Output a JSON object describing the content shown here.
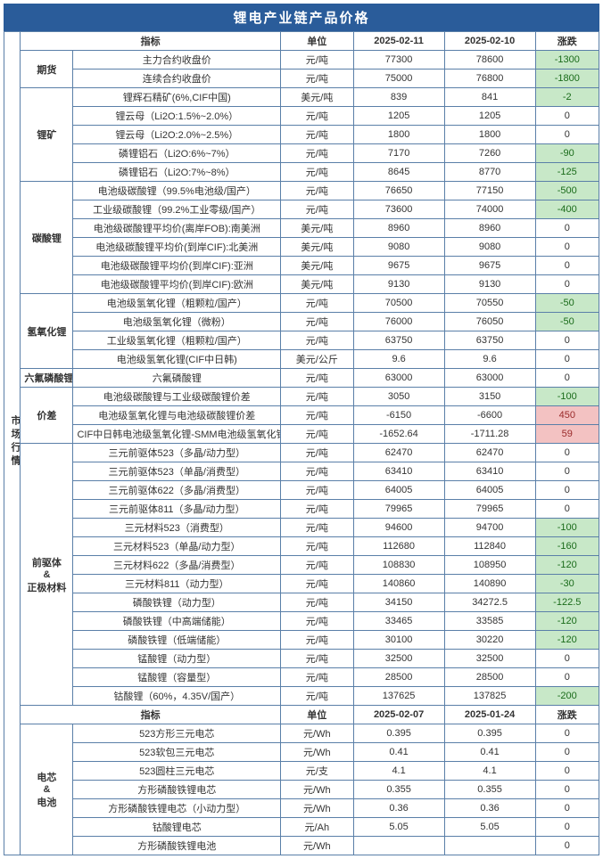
{
  "title": "锂电产业链产品价格",
  "headers1": {
    "indicator": "指标",
    "unit": "单位",
    "d1": "2025-02-11",
    "d2": "2025-02-10",
    "chg": "涨跌"
  },
  "headers2": {
    "indicator": "指标",
    "unit": "单位",
    "d1": "2025-02-07",
    "d2": "2025-01-24",
    "chg": "涨跌"
  },
  "section_main": "市场行情",
  "groups": [
    {
      "name": "期货",
      "rows": [
        {
          "ind": "主力合约收盘价",
          "unit": "元/吨",
          "v1": "77300",
          "v2": "78600",
          "chg": -1300
        },
        {
          "ind": "连续合约收盘价",
          "unit": "元/吨",
          "v1": "75000",
          "v2": "76800",
          "chg": -1800
        }
      ]
    },
    {
      "name": "锂矿",
      "rows": [
        {
          "ind": "锂辉石精矿(6%,CIF中国)",
          "unit": "美元/吨",
          "v1": "839",
          "v2": "841",
          "chg": -2
        },
        {
          "ind": "锂云母（Li2O:1.5%~2.0%）",
          "unit": "元/吨",
          "v1": "1205",
          "v2": "1205",
          "chg": 0
        },
        {
          "ind": "锂云母（Li2O:2.0%~2.5%）",
          "unit": "元/吨",
          "v1": "1800",
          "v2": "1800",
          "chg": 0
        },
        {
          "ind": "磷锂铝石（Li2O:6%~7%）",
          "unit": "元/吨",
          "v1": "7170",
          "v2": "7260",
          "chg": -90
        },
        {
          "ind": "磷锂铝石（Li2O:7%~8%）",
          "unit": "元/吨",
          "v1": "8645",
          "v2": "8770",
          "chg": -125
        }
      ]
    },
    {
      "name": "碳酸锂",
      "rows": [
        {
          "ind": "电池级碳酸锂（99.5%电池级/国产）",
          "unit": "元/吨",
          "v1": "76650",
          "v2": "77150",
          "chg": -500
        },
        {
          "ind": "工业级碳酸锂（99.2%工业零级/国产）",
          "unit": "元/吨",
          "v1": "73600",
          "v2": "74000",
          "chg": -400
        },
        {
          "ind": "电池级碳酸锂平均价(离岸FOB):南美洲",
          "unit": "美元/吨",
          "v1": "8960",
          "v2": "8960",
          "chg": 0
        },
        {
          "ind": "电池级碳酸锂平均价(到岸CIF):北美洲",
          "unit": "美元/吨",
          "v1": "9080",
          "v2": "9080",
          "chg": 0
        },
        {
          "ind": "电池级碳酸锂平均价(到岸CIF):亚洲",
          "unit": "美元/吨",
          "v1": "9675",
          "v2": "9675",
          "chg": 0
        },
        {
          "ind": "电池级碳酸锂平均价(到岸CIF):欧洲",
          "unit": "美元/吨",
          "v1": "9130",
          "v2": "9130",
          "chg": 0
        }
      ]
    },
    {
      "name": "氢氧化锂",
      "rows": [
        {
          "ind": "电池级氢氧化锂（粗颗粒/国产）",
          "unit": "元/吨",
          "v1": "70500",
          "v2": "70550",
          "chg": -50
        },
        {
          "ind": "电池级氢氧化锂（微粉）",
          "unit": "元/吨",
          "v1": "76000",
          "v2": "76050",
          "chg": -50
        },
        {
          "ind": "工业级氢氧化锂（粗颗粒/国产）",
          "unit": "元/吨",
          "v1": "63750",
          "v2": "63750",
          "chg": 0
        },
        {
          "ind": "电池级氢氧化锂(CIF中日韩)",
          "unit": "美元/公斤",
          "v1": "9.6",
          "v2": "9.6",
          "chg": 0
        }
      ]
    },
    {
      "name": "六氟磷酸锂",
      "rows": [
        {
          "ind": "六氟磷酸锂",
          "unit": "元/吨",
          "v1": "63000",
          "v2": "63000",
          "chg": 0
        }
      ]
    },
    {
      "name": "价差",
      "rows": [
        {
          "ind": "电池级碳酸锂与工业级碳酸锂价差",
          "unit": "元/吨",
          "v1": "3050",
          "v2": "3150",
          "chg": -100
        },
        {
          "ind": "电池级氢氧化锂与电池级碳酸锂价差",
          "unit": "元/吨",
          "v1": "-6150",
          "v2": "-6600",
          "chg": 450
        },
        {
          "ind": "CIF中日韩电池级氢氧化锂-SMM电池级氢氧化锂",
          "unit": "元/吨",
          "v1": "-1652.64",
          "v2": "-1711.28",
          "chg": 59
        }
      ]
    },
    {
      "name": "前驱体&正极材料",
      "multiline": true,
      "rows": [
        {
          "ind": "三元前驱体523（多晶/动力型）",
          "unit": "元/吨",
          "v1": "62470",
          "v2": "62470",
          "chg": 0
        },
        {
          "ind": "三元前驱体523（单晶/消费型）",
          "unit": "元/吨",
          "v1": "63410",
          "v2": "63410",
          "chg": 0
        },
        {
          "ind": "三元前驱体622（多晶/消费型）",
          "unit": "元/吨",
          "v1": "64005",
          "v2": "64005",
          "chg": 0
        },
        {
          "ind": "三元前驱体811（多晶/动力型）",
          "unit": "元/吨",
          "v1": "79965",
          "v2": "79965",
          "chg": 0
        },
        {
          "ind": "三元材料523（消费型）",
          "unit": "元/吨",
          "v1": "94600",
          "v2": "94700",
          "chg": -100
        },
        {
          "ind": "三元材料523（单晶/动力型）",
          "unit": "元/吨",
          "v1": "112680",
          "v2": "112840",
          "chg": -160
        },
        {
          "ind": "三元材料622（多晶/消费型）",
          "unit": "元/吨",
          "v1": "108830",
          "v2": "108950",
          "chg": -120
        },
        {
          "ind": "三元材料811（动力型）",
          "unit": "元/吨",
          "v1": "140860",
          "v2": "140890",
          "chg": -30
        },
        {
          "ind": "磷酸铁锂（动力型）",
          "unit": "元/吨",
          "v1": "34150",
          "v2": "34272.5",
          "chg": -122.5
        },
        {
          "ind": "磷酸铁锂（中高端储能）",
          "unit": "元/吨",
          "v1": "33465",
          "v2": "33585",
          "chg": -120
        },
        {
          "ind": "磷酸铁锂（低端储能）",
          "unit": "元/吨",
          "v1": "30100",
          "v2": "30220",
          "chg": -120
        },
        {
          "ind": "锰酸锂（动力型）",
          "unit": "元/吨",
          "v1": "32500",
          "v2": "32500",
          "chg": 0
        },
        {
          "ind": "锰酸锂（容量型）",
          "unit": "元/吨",
          "v1": "28500",
          "v2": "28500",
          "chg": 0
        },
        {
          "ind": "钴酸锂（60%，4.35V/国产）",
          "unit": "元/吨",
          "v1": "137625",
          "v2": "137825",
          "chg": -200
        }
      ]
    }
  ],
  "groups2": [
    {
      "name": "电芯&电池",
      "multiline": true,
      "rows": [
        {
          "ind": "523方形三元电芯",
          "unit": "元/Wh",
          "v1": "0.395",
          "v2": "0.395",
          "chg": 0
        },
        {
          "ind": "523软包三元电芯",
          "unit": "元/Wh",
          "v1": "0.41",
          "v2": "0.41",
          "chg": 0
        },
        {
          "ind": "523圆柱三元电芯",
          "unit": "元/支",
          "v1": "4.1",
          "v2": "4.1",
          "chg": 0
        },
        {
          "ind": "方形磷酸铁锂电芯",
          "unit": "元/Wh",
          "v1": "0.355",
          "v2": "0.355",
          "chg": 0
        },
        {
          "ind": "方形磷酸铁锂电芯（小动力型）",
          "unit": "元/Wh",
          "v1": "0.36",
          "v2": "0.36",
          "chg": 0
        },
        {
          "ind": "钴酸锂电芯",
          "unit": "元/Ah",
          "v1": "5.05",
          "v2": "5.05",
          "chg": 0
        },
        {
          "ind": "方形磷酸铁锂电池",
          "unit": "元/Wh",
          "v1": "",
          "v2": "",
          "chg": 0
        }
      ]
    }
  ]
}
